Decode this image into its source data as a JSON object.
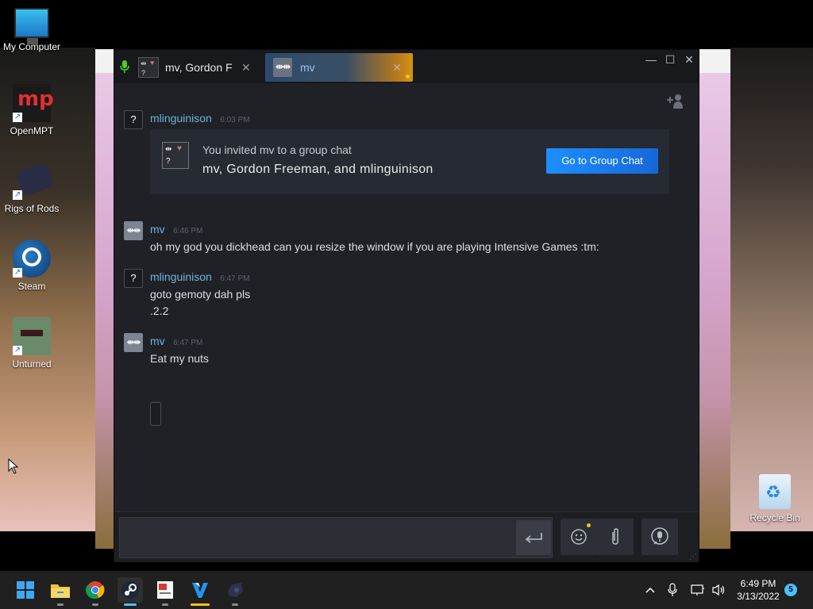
{
  "desktop": {
    "icons": [
      {
        "label": "My Computer"
      },
      {
        "label": "OpenMPT"
      },
      {
        "label": "Rigs of Rods"
      },
      {
        "label": "Steam"
      },
      {
        "label": "Unturned"
      },
      {
        "label": "Recycle Bin"
      }
    ]
  },
  "steam_chat": {
    "tabs": [
      {
        "label": "mv, Gordon F",
        "active": false
      },
      {
        "label": "mv",
        "active": true
      }
    ],
    "messages": [
      {
        "sender": "mlinguinison",
        "time": "6:03 PM",
        "avatar": "?",
        "lines": []
      },
      {
        "sender": "mv",
        "time": "6:46 PM",
        "avatar": "mv-avatar",
        "lines": [
          "oh my god you dickhead can you resize the window if you are playing Intensive Games :tm:"
        ]
      },
      {
        "sender": "mlinguinison",
        "time": "6:47 PM",
        "avatar": "?",
        "lines": [
          "goto gemoty dah pls",
          ".2.2"
        ]
      },
      {
        "sender": "mv",
        "time": "6:47 PM",
        "avatar": "mv-avatar",
        "lines": [
          "Eat my nuts"
        ]
      }
    ],
    "invite": {
      "line1": "You invited mv to a group chat",
      "line2": "mv, Gordon Freeman, and mlinguinison",
      "button": "Go to Group Chat"
    },
    "composer": {
      "value": ""
    }
  },
  "taskbar": {
    "apps": [
      "start",
      "file-explorer",
      "chrome",
      "steam",
      "openmpt",
      "visual-studio",
      "rigs-of-rods"
    ],
    "clock": {
      "time": "6:49 PM",
      "date": "3/13/2022"
    },
    "notifications": "5"
  },
  "colors": {
    "accent_blue": "#1a8cff",
    "name_blue": "#6fb4d6",
    "window_bg": "#1f2126",
    "taskbar": "#202020"
  }
}
